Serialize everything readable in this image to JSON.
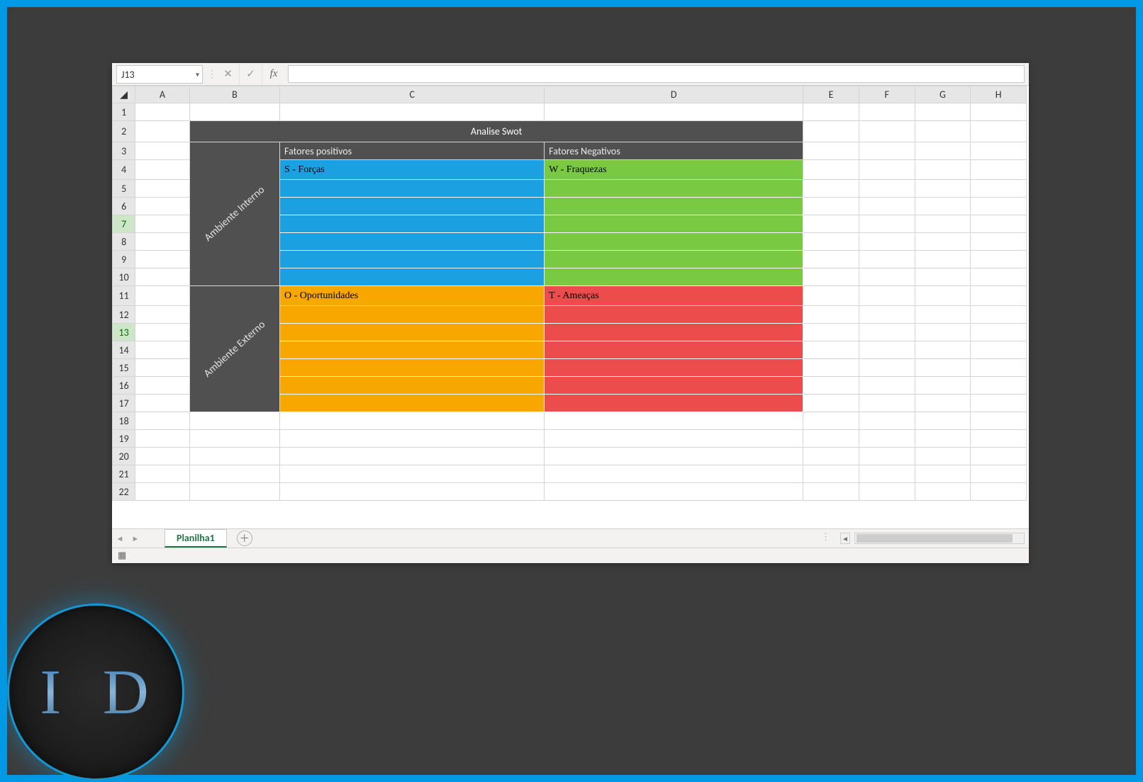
{
  "nameBox": "J13",
  "columns": [
    "A",
    "B",
    "C",
    "D",
    "E",
    "F",
    "G",
    "H"
  ],
  "rows": [
    1,
    2,
    3,
    4,
    5,
    6,
    7,
    8,
    9,
    10,
    11,
    12,
    13,
    14,
    15,
    16,
    17,
    18,
    19,
    20,
    21,
    22
  ],
  "highlightedRows": [
    7,
    13
  ],
  "swot": {
    "title": "Analise Swot",
    "posHeader": "Fatores positivos",
    "negHeader": "Fatores Negativos",
    "internalLabel": "Ambiente Interno",
    "externalLabel": "Ambiente Externo",
    "s": "S - Forças",
    "w": "W - Fraquezas",
    "o": "O - Oportunidades",
    "t": "T - Ameaças"
  },
  "sheetTab": "Planilha1",
  "logo": "I D",
  "statusIcon": "▦"
}
